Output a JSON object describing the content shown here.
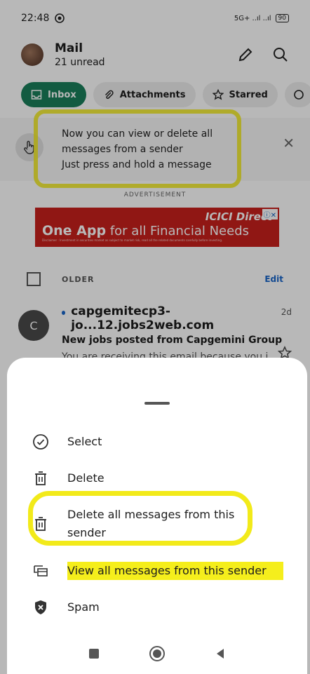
{
  "status": {
    "time": "22:48",
    "network": "5G+ ..ıl ..ıl",
    "battery": "90"
  },
  "header": {
    "title": "Mail",
    "subtitle": "21 unread"
  },
  "tabs": [
    {
      "label": "Inbox",
      "active": true
    },
    {
      "label": "Attachments",
      "active": false
    },
    {
      "label": "Starred",
      "active": false
    }
  ],
  "tip": {
    "line1": "Now you can view or delete all",
    "line2": "messages from a sender",
    "line3": "Just press and hold a message"
  },
  "ad": {
    "label": "ADVERTISEMENT",
    "brand": "ICICI Direct",
    "headline_bold": "One App",
    "headline_rest": " for all Financial Needs",
    "disclaimer": "Disclaimer : Investment in securities market as subject to market risk, read all the related documents carefully before investing."
  },
  "section": {
    "label": "OLDER",
    "edit": "Edit"
  },
  "email": {
    "avatar_letter": "C",
    "sender": "capgemitecp3-jo...12.jobs2web.com",
    "time": "2d",
    "subject": "New jobs posted from Capgemini Group",
    "preview": "You are receiving this email because you j..."
  },
  "sheet_menu": [
    {
      "label": "Select",
      "icon": "check-circle-icon"
    },
    {
      "label": "Delete",
      "icon": "trash-icon"
    },
    {
      "label": "Delete all messages from this sender",
      "icon": "trash-all-icon"
    },
    {
      "label": "View all messages from this sender",
      "icon": "view-sender-icon"
    },
    {
      "label": "Spam",
      "icon": "shield-x-icon"
    }
  ],
  "colors": {
    "accent": "#1a7f5a",
    "link": "#1a66c9",
    "highlight": "#f2ea1a"
  }
}
